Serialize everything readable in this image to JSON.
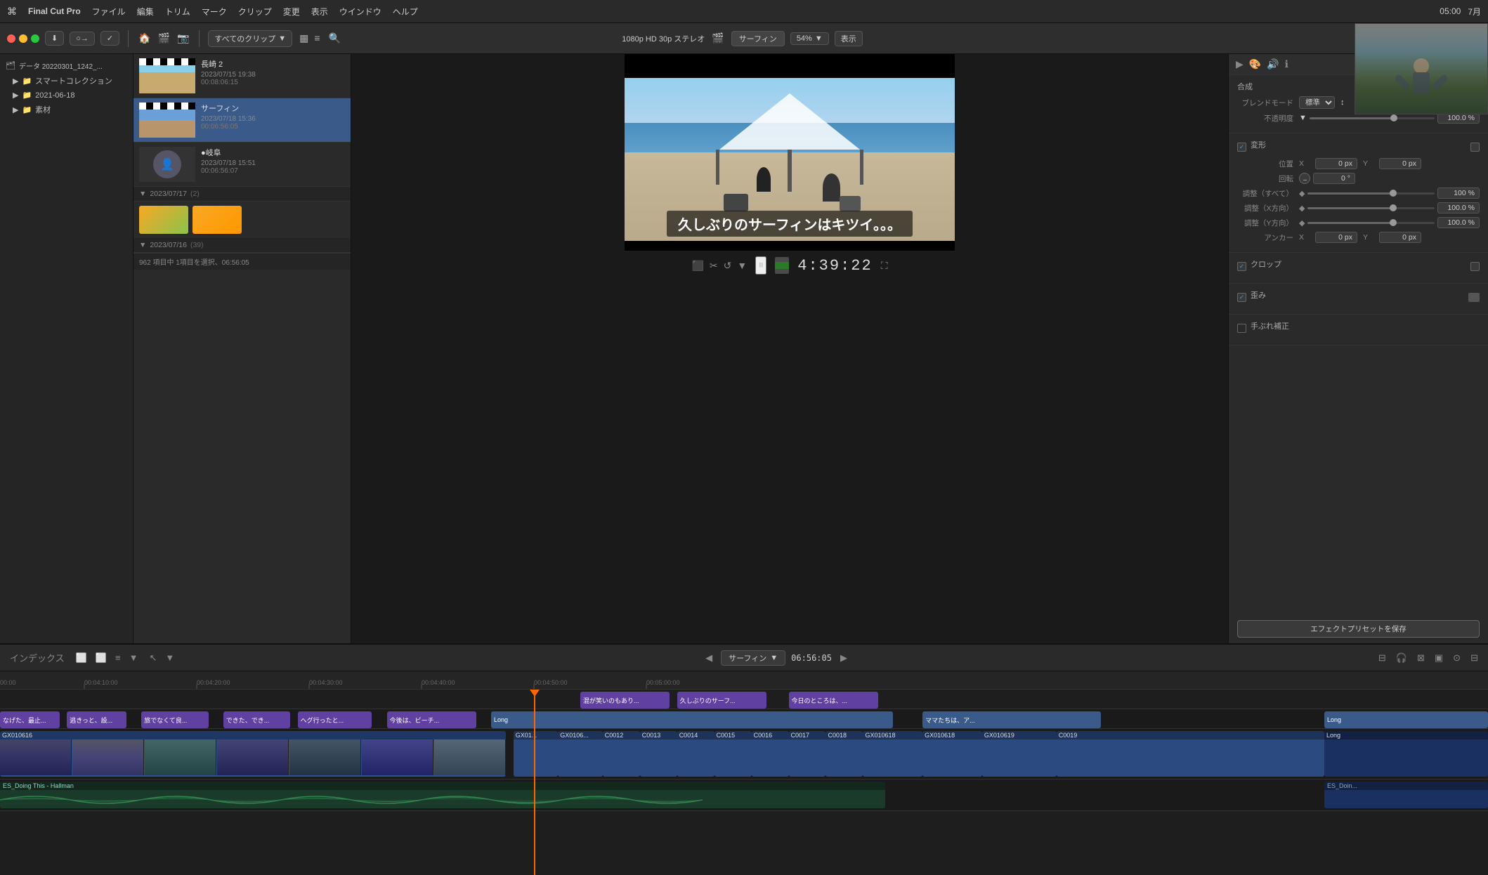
{
  "menubar": {
    "apple": "⌘",
    "app_name": "Final Cut Pro",
    "menus": [
      "ファイル",
      "編集",
      "トリム",
      "マーク",
      "クリップ",
      "変更",
      "表示",
      "ウインドウ",
      "ヘルプ"
    ],
    "right_items": [
      "05:00",
      "7月"
    ]
  },
  "toolbar": {
    "clip_filter": "すべてのクリップ",
    "resolution": "1080p HD 30p ステレオ",
    "clip_name": "サーフィン",
    "zoom": "54%",
    "view_label": "表示",
    "clip_id": "GX010616"
  },
  "library": {
    "items": [
      {
        "id": "data",
        "label": "データ 20220301_1242_...",
        "icon": "📂",
        "indent": 0
      },
      {
        "id": "smart",
        "label": "スマートコレクション",
        "icon": "📁",
        "indent": 1
      },
      {
        "id": "2021",
        "label": "2021-06-18",
        "icon": "📁",
        "indent": 1
      },
      {
        "id": "sozai",
        "label": "素材",
        "icon": "📁",
        "indent": 1
      }
    ]
  },
  "clips": [
    {
      "name": "長崎 2",
      "date": "2023/07/15 19:38",
      "duration": "00:08:06:15",
      "thumb_type": "beach"
    },
    {
      "name": "サーフィン",
      "date": "2023/07/18 15:36",
      "duration": "00:06:56:05",
      "thumb_type": "surf"
    },
    {
      "name": "●岐阜",
      "date": "2023/07/18 15:51",
      "duration": "00:06:56:07",
      "thumb_type": "dark"
    }
  ],
  "section_2023_07_17": {
    "label": "2023/07/17",
    "count": "(2)"
  },
  "section_2023_07_16": {
    "label": "2023/07/16",
    "count": "(39)"
  },
  "status_bar": {
    "text": "962 項目中 1項目を選択、06:56:05"
  },
  "viewer": {
    "subtitle": "久しぶりのサーフィンはキツイ。。。",
    "timecode": "4:39:22",
    "clip_name": "サーフィン",
    "clip_duration": "06:56:05"
  },
  "inspector": {
    "clip_id": "GX010616",
    "sections": {
      "composite": {
        "title": "合成",
        "blend_mode_label": "ブレンドモード",
        "blend_mode_value": "標準",
        "opacity_label": "不透明度",
        "opacity_value": "100.0 %"
      },
      "transform": {
        "title": "変形",
        "position_label": "位置",
        "position_x": "0 px",
        "position_x_label": "X",
        "position_y": "0 px",
        "position_y_label": "Y",
        "rotation_label": "回転",
        "rotation_value": "0 °",
        "scale_all_label": "調整（すべて）",
        "scale_all_value": "100 %",
        "scale_x_label": "調整（X方向）",
        "scale_x_value": "100.0 %",
        "scale_y_label": "調整（Y方向）",
        "scale_y_value": "100.0 %",
        "anchor_label": "アンカー",
        "anchor_x": "0 px",
        "anchor_x_label": "X",
        "anchor_y": "0 px",
        "anchor_y_label": "Y"
      },
      "crop": {
        "title": "クロップ"
      },
      "distort": {
        "title": "歪み"
      },
      "stabilize": {
        "title": "手ぶれ補正"
      }
    },
    "save_preset_label": "エフェクトプリセットを保存"
  },
  "timeline": {
    "toolbar": {
      "index_label": "インデックス",
      "clip_name": "サーフィン",
      "timecode": "06:56:05"
    },
    "ruler": {
      "marks": [
        "00:00",
        "00:04:10:00",
        "00:04:20:00",
        "00:04:30:00",
        "00:04:40:00",
        "00:04:50:00",
        "00:05:00:00"
      ]
    },
    "subtitle_clips": [
      {
        "text": "なげた、最止...",
        "color": "purple",
        "left_pct": 0,
        "width_pct": 4
      },
      {
        "text": "逃きっと、設...",
        "color": "purple",
        "left_pct": 4.5,
        "width_pct": 4
      },
      {
        "text": "旅でなくて良...",
        "color": "purple",
        "left_pct": 9.5,
        "width_pct": 4.5
      },
      {
        "text": "できた、でき...",
        "color": "purple",
        "left_pct": 15,
        "width_pct": 4.5
      },
      {
        "text": "ヘグ行ったと...",
        "color": "purple",
        "left_pct": 20,
        "width_pct": 5
      },
      {
        "text": "今後は、ビーチ...",
        "color": "purple",
        "left_pct": 26,
        "width_pct": 6
      },
      {
        "text": "Long",
        "color": "darkblue",
        "left_pct": 33,
        "width_pct": 27
      },
      {
        "text": "混が笑いのもあり...",
        "color": "purple2",
        "left_pct": 39,
        "width_pct": 6
      },
      {
        "text": "久しぶりのサーフ...",
        "color": "purple2",
        "left_pct": 45.5,
        "width_pct": 6
      },
      {
        "text": "今日のところは、...",
        "color": "purple2",
        "left_pct": 53,
        "width_pct": 6
      },
      {
        "text": "ママたちは、ア...",
        "color": "darkblue",
        "left_pct": 62,
        "width_pct": 12
      },
      {
        "text": "Long",
        "color": "darkblue",
        "left_pct": 89,
        "width_pct": 11
      }
    ],
    "video_clips": [
      {
        "id": "GX010616",
        "left_pct": 0,
        "width_pct": 34,
        "color": "blue"
      },
      {
        "id": "GX01...",
        "left_pct": 34.5,
        "width_pct": 3,
        "color": "blue"
      },
      {
        "id": "GX0106...",
        "left_pct": 37.5,
        "width_pct": 3,
        "color": "blue"
      },
      {
        "id": "C0012",
        "left_pct": 40.5,
        "width_pct": 2.5,
        "color": "blue"
      },
      {
        "id": "C0013",
        "left_pct": 43,
        "width_pct": 2.5,
        "color": "blue"
      },
      {
        "id": "C0014",
        "left_pct": 45.5,
        "width_pct": 2.5,
        "color": "blue"
      },
      {
        "id": "C0015",
        "left_pct": 48,
        "width_pct": 2.5,
        "color": "blue"
      },
      {
        "id": "C0016",
        "left_pct": 50.5,
        "width_pct": 2.5,
        "color": "blue"
      },
      {
        "id": "C0017",
        "left_pct": 53,
        "width_pct": 2.5,
        "color": "blue"
      },
      {
        "id": "C0018",
        "left_pct": 55.5,
        "width_pct": 2.5,
        "color": "blue"
      },
      {
        "id": "GX010618",
        "left_pct": 58,
        "width_pct": 4,
        "color": "blue"
      },
      {
        "id": "GX010618",
        "left_pct": 62,
        "width_pct": 4,
        "color": "blue"
      },
      {
        "id": "GX010619",
        "left_pct": 66,
        "width_pct": 5,
        "color": "blue"
      },
      {
        "id": "C0019",
        "left_pct": 71,
        "width_pct": 12,
        "color": "blue"
      },
      {
        "id": "Long_end",
        "left_pct": 89,
        "width_pct": 11,
        "color": "darkblue"
      }
    ],
    "audio_clips": [
      {
        "id": "ES_Doing This - Hallman",
        "left_pct": 0,
        "width_pct": 60,
        "color": "darkgreen"
      },
      {
        "id": "ES_Doin...",
        "left_pct": 89,
        "width_pct": 11,
        "color": "darkblue"
      }
    ]
  },
  "icons": {
    "play": "▶",
    "pause": "⏸",
    "skip_back": "⏮",
    "skip_fwd": "⏭",
    "fullscreen": "⛶",
    "search": "🔍",
    "settings": "⚙",
    "info": "ℹ",
    "audio": "🔊",
    "chevron_down": "▼",
    "chevron_right": "▶",
    "triangle_right": "▶",
    "film": "🎬",
    "prev": "◀",
    "next": "▶"
  }
}
